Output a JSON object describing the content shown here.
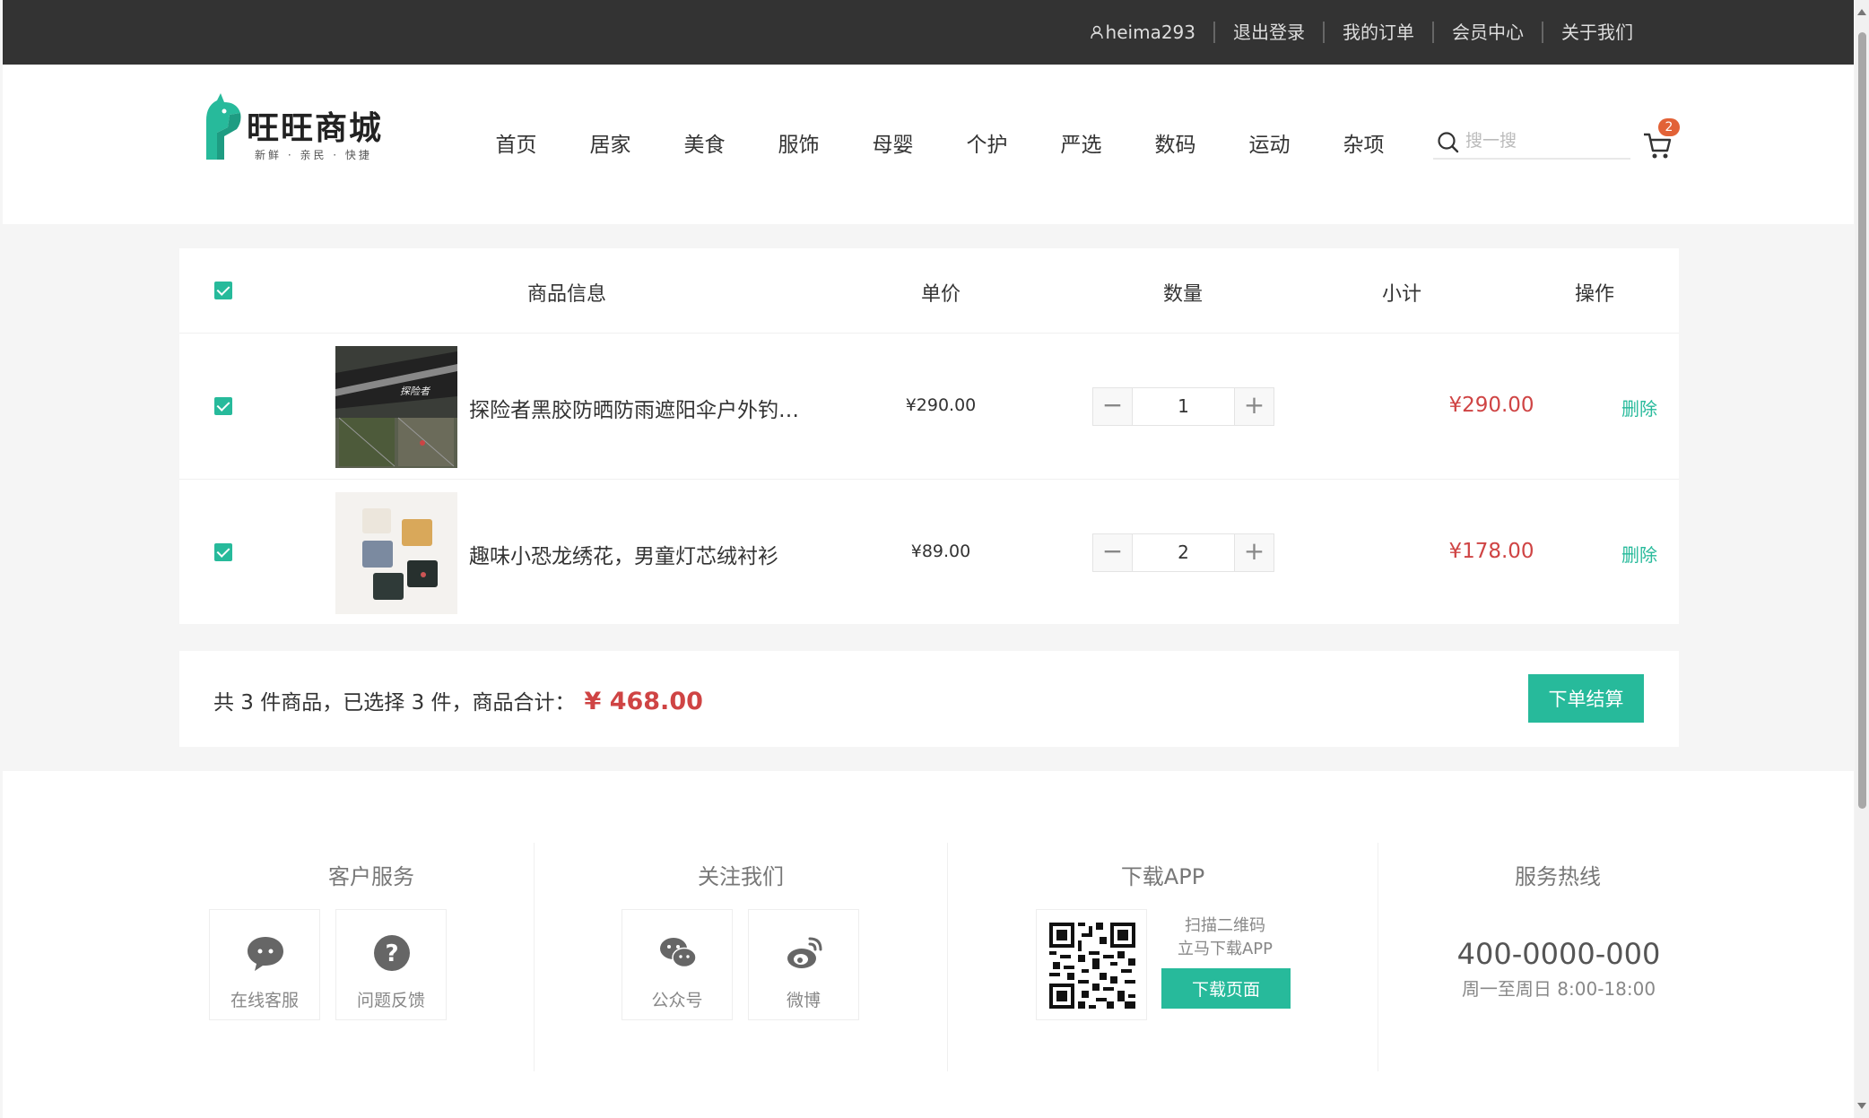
{
  "topbar": {
    "username": "heima293",
    "links": [
      "退出登录",
      "我的订单",
      "会员中心",
      "关于我们"
    ]
  },
  "logo": {
    "title": "旺旺商城",
    "subtitle": "新鲜 · 亲民 · 快捷"
  },
  "nav": [
    "首页",
    "居家",
    "美食",
    "服饰",
    "母婴",
    "个护",
    "严选",
    "数码",
    "运动",
    "杂项"
  ],
  "search": {
    "placeholder": "搜一搜"
  },
  "cart": {
    "badge": "2"
  },
  "table": {
    "headers": {
      "info": "商品信息",
      "price": "单价",
      "qty": "数量",
      "subtotal": "小计",
      "action": "操作"
    },
    "rows": [
      {
        "name": "探险者黑胶防晒防雨遮阳伞户外钓鱼伞",
        "price": "¥290.00",
        "qty": "1",
        "subtotal": "¥290.00",
        "action": "删除"
      },
      {
        "name": "趣味小恐龙绣花，男童灯芯绒衬衫",
        "price": "¥89.00",
        "qty": "2",
        "subtotal": "¥178.00",
        "action": "删除"
      }
    ]
  },
  "summary": {
    "text": "共 3 件商品，已选择 3 件，商品合计：",
    "total": "¥ 468.00",
    "checkout": "下单结算"
  },
  "footer": {
    "service": {
      "title": "客户服务",
      "items": [
        "在线客服",
        "问题反馈"
      ]
    },
    "follow": {
      "title": "关注我们",
      "items": [
        "公众号",
        "微博"
      ]
    },
    "app": {
      "title": "下载APP",
      "line1": "扫描二维码",
      "line2": "立马下载APP",
      "button": "下载页面"
    },
    "hotline": {
      "title": "服务热线",
      "number": "400-0000-000",
      "hours": "周一至周日 8:00-18:00"
    }
  },
  "colors": {
    "accent": "#27ba9b",
    "price": "#cf4444",
    "topbar": "#333333"
  }
}
